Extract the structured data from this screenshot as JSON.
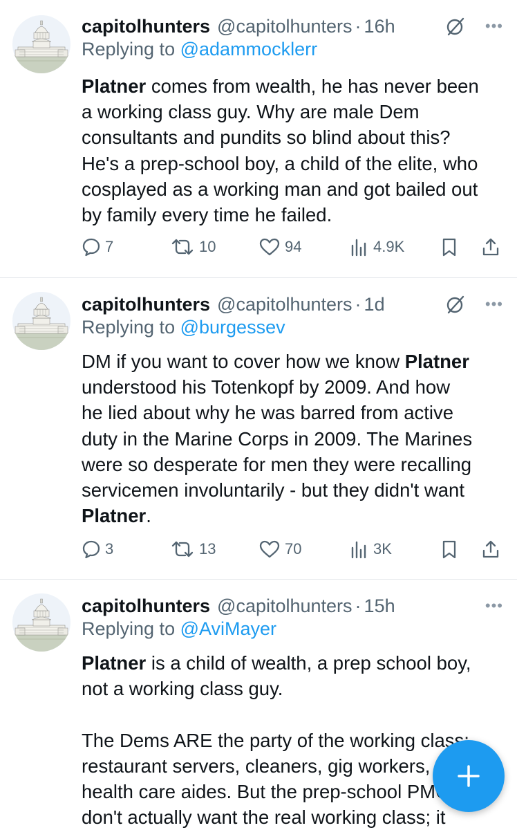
{
  "colors": {
    "accent": "#1d9bf0",
    "secondary_text": "#536471",
    "primary_text": "#0f1419",
    "divider": "#e6e9ec"
  },
  "tweets": [
    {
      "name": "capitolhunters",
      "handle": "@capitolhunters",
      "time": "16h",
      "reply_label": "Replying to",
      "reply_to": "@adammocklerr",
      "lines": [
        [
          {
            "b": true,
            "t": "Platner"
          },
          {
            "t": " comes from wealth, he has never been"
          }
        ],
        [
          {
            "t": "a working class guy. Why are male Dem"
          }
        ],
        [
          {
            "t": "consultants and pundits so blind about this?"
          }
        ],
        [
          {
            "t": "He's a prep-school boy, a child of the elite, who"
          }
        ],
        [
          {
            "t": "cosplayed as a working man and got bailed out"
          }
        ],
        [
          {
            "t": "by family every time he failed."
          }
        ]
      ],
      "replies": "7",
      "reposts": "10",
      "likes": "94",
      "views": "4.9K",
      "has_grok": true
    },
    {
      "name": "capitolhunters",
      "handle": "@capitolhunters",
      "time": "1d",
      "reply_label": "Replying to",
      "reply_to": "@burgessev",
      "lines": [
        [
          {
            "t": "DM if you want to cover how we know "
          },
          {
            "b": true,
            "t": "Platner"
          }
        ],
        [
          {
            "t": "understood his Totenkopf by 2009. And how"
          }
        ],
        [
          {
            "t": "he lied about why he was barred from active"
          }
        ],
        [
          {
            "t": "duty in the Marine Corps in 2009. The Marines"
          }
        ],
        [
          {
            "t": "were so desperate for men they were recalling"
          }
        ],
        [
          {
            "t": "servicemen involuntarily - but they didn't want"
          }
        ],
        [
          {
            "b": true,
            "t": "Platner"
          },
          {
            "t": "."
          }
        ]
      ],
      "replies": "3",
      "reposts": "13",
      "likes": "70",
      "views": "3K",
      "has_grok": true
    },
    {
      "name": "capitolhunters",
      "handle": "@capitolhunters",
      "time": "15h",
      "reply_label": "Replying to",
      "reply_to": "@AviMayer",
      "lines": [
        [
          {
            "b": true,
            "t": "Platner"
          },
          {
            "t": " is a child of wealth, a prep school boy,"
          }
        ],
        [
          {
            "t": "not a working class guy."
          }
        ],
        [],
        [
          {
            "t": "The Dems ARE the party of the working class:"
          }
        ],
        [
          {
            "t": "restaurant servers, cleaners, gig workers,"
          }
        ],
        [
          {
            "t": "health care aides. But the prep-school PMC"
          }
        ],
        [
          {
            "t": "don't actually want the real working class; it"
          }
        ]
      ],
      "has_grok": false
    }
  ],
  "fab": {
    "icon": "plus-icon"
  }
}
